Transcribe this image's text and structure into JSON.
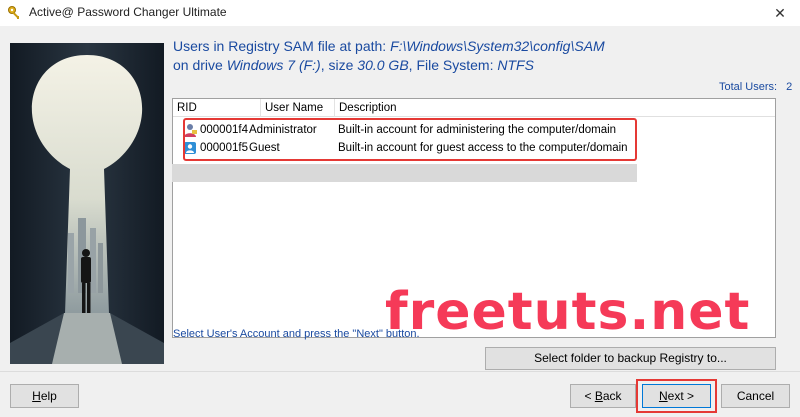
{
  "window": {
    "title": "Active@ Password Changer Ultimate",
    "close_glyph": "✕"
  },
  "header": {
    "line1_prefix": "Users in Registry SAM file at path: ",
    "sam_path": "F:\\Windows\\System32\\config\\SAM",
    "line2_prefix": "on drive ",
    "drive": "Windows 7 (F:)",
    "size_label": ", size ",
    "size": "30.0 GB",
    "fs_label": ", File System: ",
    "fs": "NTFS"
  },
  "total_users": {
    "label": "Total Users:",
    "count": "2"
  },
  "table": {
    "columns": [
      "RID",
      "User Name",
      "Description"
    ],
    "rows": [
      {
        "rid": "000001f4",
        "user": "Administrator",
        "description": "Built-in account for administering the computer/domain",
        "icon": "admin-user-icon"
      },
      {
        "rid": "000001f5",
        "user": "Guest",
        "description": "Built-in account for guest access to the computer/domain",
        "icon": "guest-user-icon"
      }
    ]
  },
  "hint": "Select User's Account and press the \"Next\" button.",
  "buttons": {
    "backup": "Select folder to backup Registry to...",
    "help_pre": "",
    "help_u": "H",
    "help_post": "elp",
    "back_pre": "< ",
    "back_u": "B",
    "back_post": "ack",
    "next_u": "N",
    "next_post": "ext >",
    "cancel": "Cancel"
  },
  "watermark": "freetuts.net",
  "colors": {
    "accent_text": "#1a4aa0",
    "highlight": "#e53935",
    "watermark": "#f52a4a"
  }
}
